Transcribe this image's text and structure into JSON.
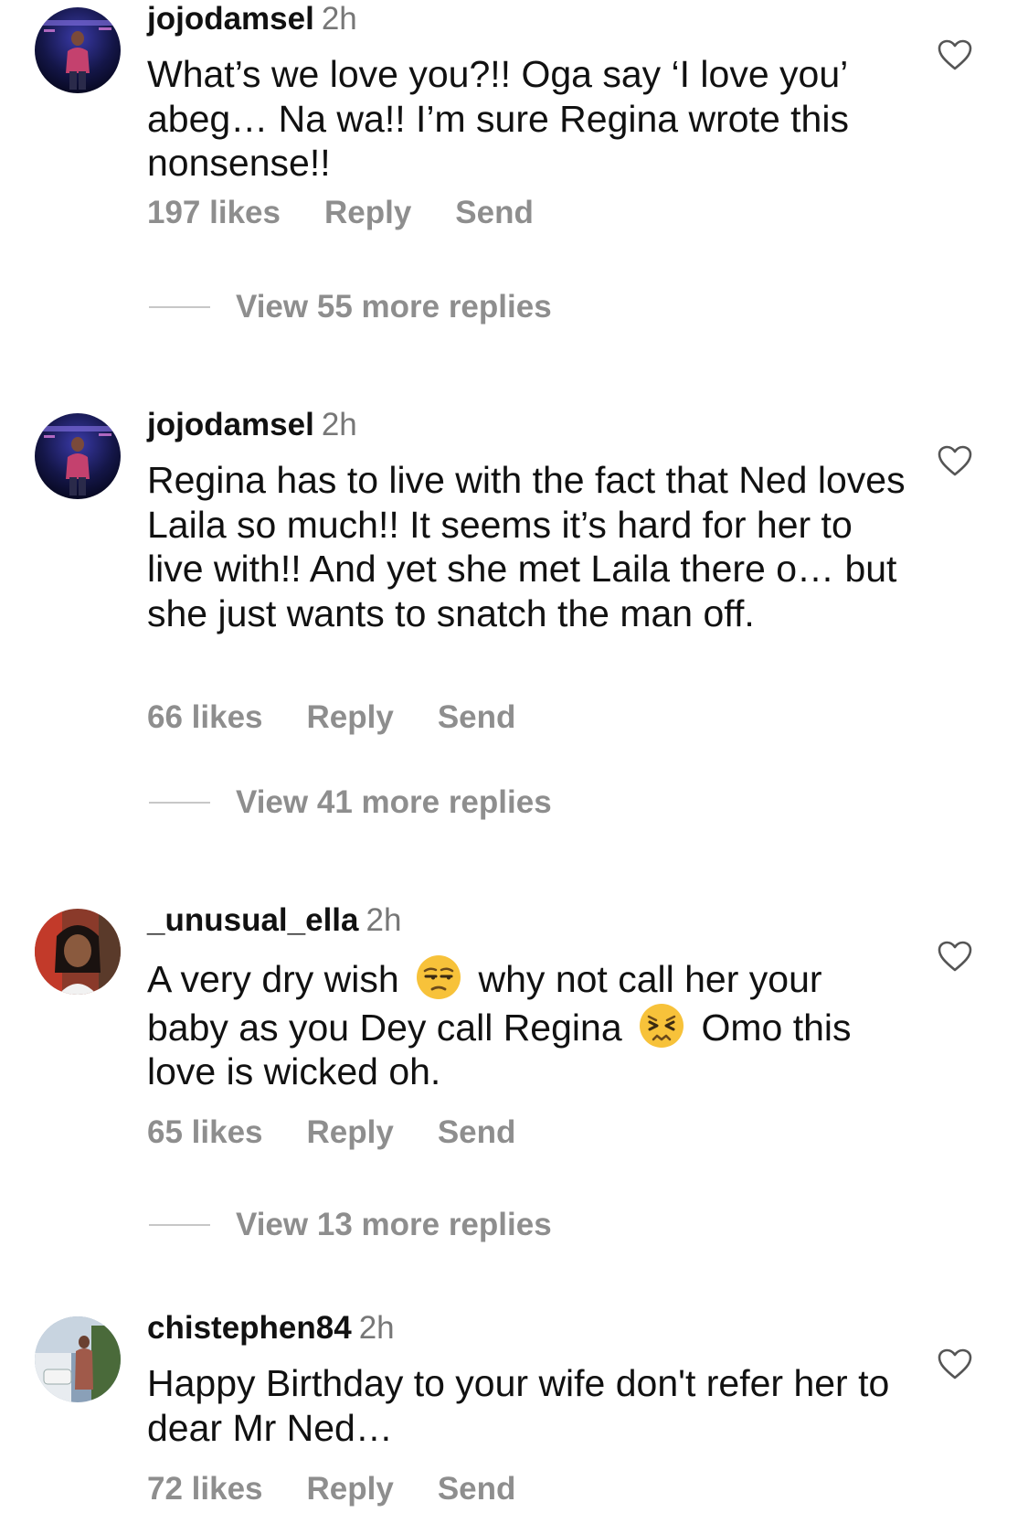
{
  "comments": [
    {
      "username": "jojodamsel",
      "time": "2h",
      "text": "What’s we love you?!! Oga say ‘I love you’ abeg… Na wa!! I’m sure Regina wrote this nonsense!!",
      "likes": "197 likes",
      "reply_label": "Reply",
      "send_label": "Send",
      "view_replies": "View 55 more replies",
      "liked": false
    },
    {
      "username": "jojodamsel",
      "time": "2h",
      "text": "Regina has to live with the fact that Ned loves Laila so much!! It seems it’s hard for her to live with!! And yet she met Laila there o… but she just wants to snatch the man off.",
      "likes": "66 likes",
      "reply_label": "Reply",
      "send_label": "Send",
      "view_replies": "View 41 more replies",
      "liked": false
    },
    {
      "username": "_unusual_ella",
      "time": "2h",
      "text_parts": [
        "A very dry wish",
        "why not call her your baby as you Dey call Regina",
        "Omo this love is wicked oh."
      ],
      "emojis": [
        "unamused-face-emoji",
        "persevering-face-emoji"
      ],
      "likes": "65 likes",
      "reply_label": "Reply",
      "send_label": "Send",
      "view_replies": "View 13 more replies",
      "liked": false
    },
    {
      "username": "chistephen84",
      "time": "2h",
      "text": "Happy Birthday to your wife don't refer her to dear Mr Ned…",
      "likes": "72 likes",
      "reply_label": "Reply",
      "send_label": "Send",
      "liked": false
    }
  ],
  "colors": {
    "text": "#111111",
    "muted": "#8e8e8e",
    "timestamp": "#777777",
    "divider": "#c7c7c7",
    "emoji_yellow": "#f7c23a"
  },
  "icons": {
    "like": "heart-outline-icon"
  }
}
